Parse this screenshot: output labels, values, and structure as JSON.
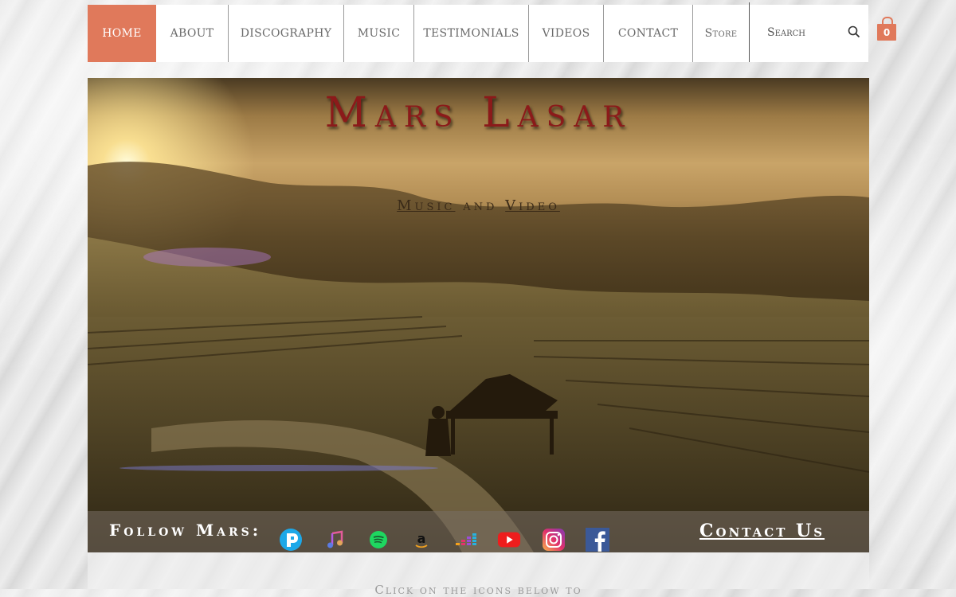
{
  "nav": {
    "items": [
      {
        "label": "HOME",
        "active": true
      },
      {
        "label": "ABOUT"
      },
      {
        "label": "DISCOGRAPHY"
      },
      {
        "label": "MUSIC"
      },
      {
        "label": "TESTIMONIALS"
      },
      {
        "label": "VIDEOS"
      },
      {
        "label": "CONTACT"
      },
      {
        "label": "Store"
      }
    ],
    "search_label": "Search",
    "accent_color": "#e0795b"
  },
  "cart": {
    "count": "0",
    "icon": "shopping-bag-icon"
  },
  "hero": {
    "title": "Mars Lasar",
    "subtitle_link1": "Music",
    "subtitle_joiner": "and",
    "subtitle_link2": "Video"
  },
  "follow": {
    "label": "Follow Mars:",
    "icons": [
      "pandora-icon",
      "apple-music-icon",
      "spotify-icon",
      "amazon-icon",
      "deezer-icon",
      "youtube-icon",
      "instagram-icon",
      "facebook-icon"
    ],
    "contact_link": "Contact Us"
  },
  "lower": {
    "text": "Click on the icons below to"
  }
}
